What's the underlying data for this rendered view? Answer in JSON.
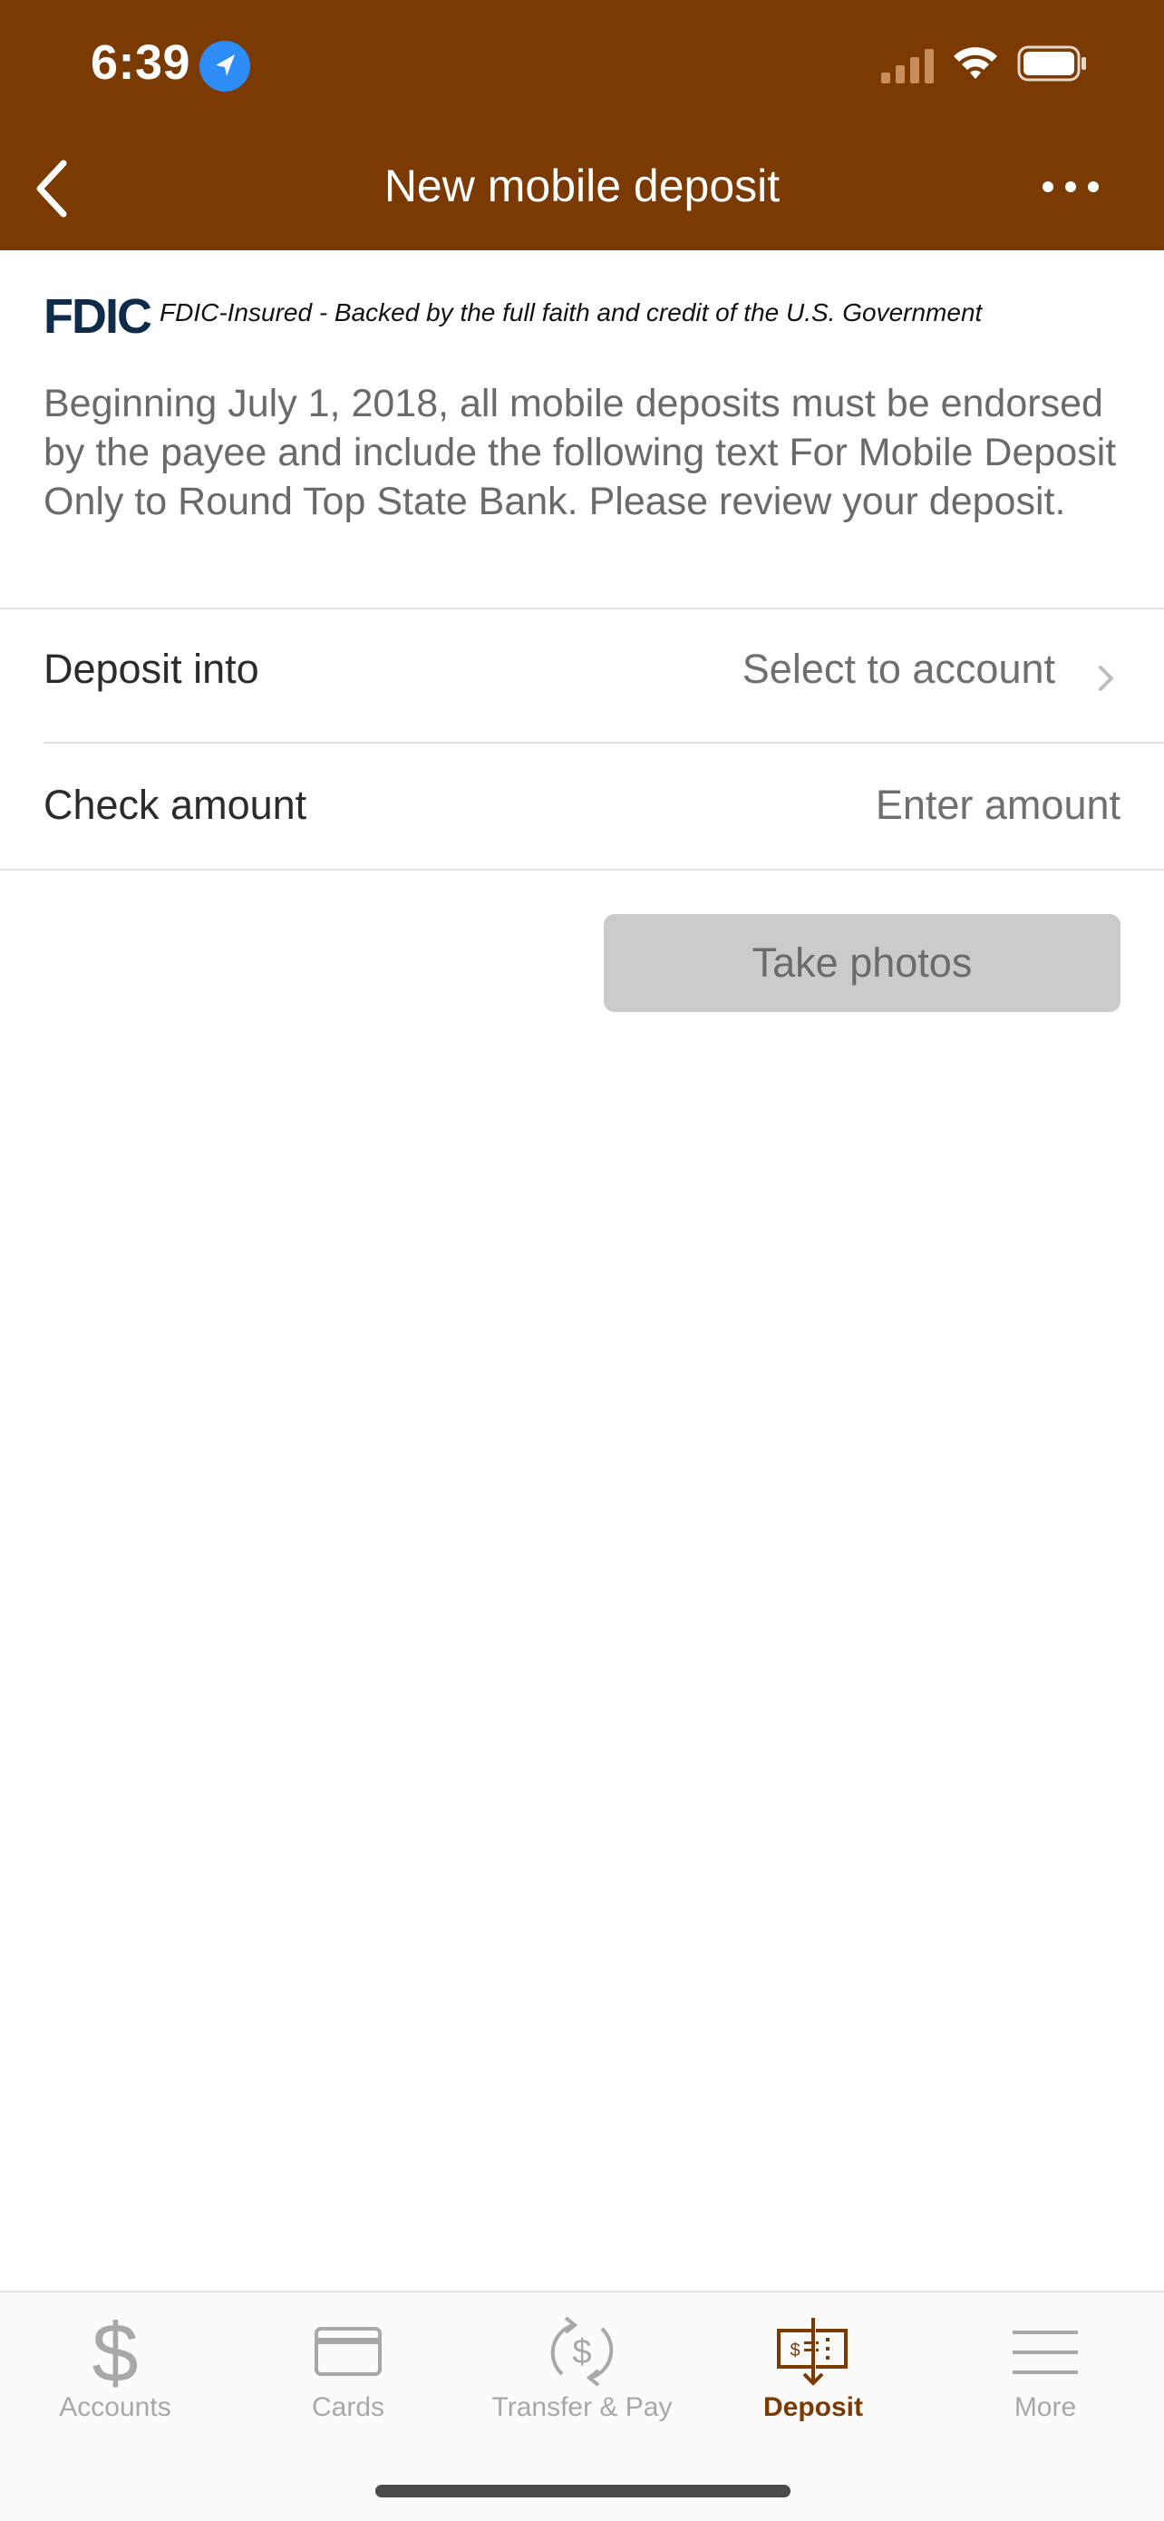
{
  "status_bar": {
    "time": "6:39"
  },
  "nav": {
    "title": "New mobile deposit"
  },
  "fdic": {
    "logo": "FDIC",
    "text": "FDIC-Insured - Backed by the full faith and credit of the U.S. Government"
  },
  "notice": "Beginning July 1, 2018, all mobile deposits must be endorsed by the payee and include the following text For Mobile Deposit Only to Round Top State Bank. Please review your deposit.",
  "form": {
    "deposit_into_label": "Deposit into",
    "deposit_into_value": "Select to account",
    "check_amount_label": "Check amount",
    "check_amount_placeholder": "Enter amount"
  },
  "take_photos_label": "Take photos",
  "tabs": [
    {
      "label": "Accounts",
      "icon": "dollar-icon",
      "active": false
    },
    {
      "label": "Cards",
      "icon": "card-icon",
      "active": false
    },
    {
      "label": "Transfer & Pay",
      "icon": "transfer-icon",
      "active": false
    },
    {
      "label": "Deposit",
      "icon": "check-deposit-icon",
      "active": true
    },
    {
      "label": "More",
      "icon": "menu-icon",
      "active": false
    }
  ],
  "colors": {
    "brand": "#7b3a02",
    "disabled_button": "#cbcbcb",
    "fdic_logo": "#0f2b4a"
  }
}
